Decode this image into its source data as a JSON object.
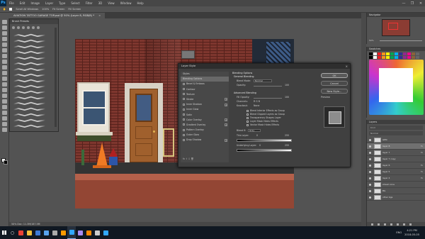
{
  "app": {
    "title_icon": "Ps"
  },
  "menubar": {
    "items": [
      "File",
      "Edit",
      "Image",
      "Layer",
      "Type",
      "Select",
      "Filter",
      "3D",
      "View",
      "Window",
      "Help"
    ],
    "win": [
      "—",
      "❐",
      "✕"
    ]
  },
  "options": {
    "items": [
      "Scroll All Windows",
      "100%",
      "Fit Screen",
      "Fill Screen"
    ]
  },
  "document": {
    "tab_label": "AVIATION TATTOO GARAGE TOP.psd @ 50% (Layer 8, RGB/8) *",
    "tab_close": "×"
  },
  "brush_panel": {
    "title": "Brush Presets"
  },
  "dialog": {
    "title": "Layer Style",
    "close": "×",
    "side_items": [
      {
        "label": "Styles",
        "cb": false,
        "plus": false,
        "sel": false
      },
      {
        "label": "Blending Options",
        "cb": false,
        "plus": false,
        "sel": true
      },
      {
        "label": "Bevel & Emboss",
        "cb": true,
        "plus": false,
        "sel": false
      },
      {
        "label": "Contour",
        "cb": true,
        "plus": false,
        "sel": false
      },
      {
        "label": "Texture",
        "cb": true,
        "plus": false,
        "sel": false
      },
      {
        "label": "Stroke",
        "cb": true,
        "plus": true,
        "sel": false
      },
      {
        "label": "Inner Shadow",
        "cb": true,
        "plus": true,
        "sel": false
      },
      {
        "label": "Inner Glow",
        "cb": true,
        "plus": false,
        "sel": false
      },
      {
        "label": "Satin",
        "cb": true,
        "plus": false,
        "sel": false
      },
      {
        "label": "Color Overlay",
        "cb": true,
        "plus": true,
        "sel": false
      },
      {
        "label": "Gradient Overlay",
        "cb": true,
        "plus": true,
        "sel": false
      },
      {
        "label": "Pattern Overlay",
        "cb": true,
        "plus": false,
        "sel": false
      },
      {
        "label": "Outer Glow",
        "cb": true,
        "plus": false,
        "sel": false
      },
      {
        "label": "Drop Shadow",
        "cb": true,
        "plus": true,
        "sel": false
      }
    ],
    "fx_label": "fx  ⇧ ⇩  🗑",
    "blending": {
      "section": "Blending Options",
      "general": "General Blending",
      "blend_mode_label": "Blend Mode:",
      "blend_mode_value": "Normal",
      "opacity_label": "Opacity:",
      "opacity_value": "100",
      "advanced": "Advanced Blending",
      "fill_label": "Fill Opacity:",
      "fill_value": "100",
      "channels_label": "Channels:",
      "channels": "R  G  B",
      "knockout_label": "Knockout:",
      "knockout_value": "None",
      "checks": [
        "Blend Interior Effects as Group",
        "Blend Clipped Layers as Group",
        "Transparency Shapes Layer",
        "Layer Mask Hides Effects",
        "Vector Mask Hides Effects"
      ],
      "blend_if_label": "Blend If:",
      "blend_if_value": "Gray",
      "this_layer": "This Layer:",
      "this_layer_lo": "0",
      "this_layer_hi": "255",
      "underlying": "Underlying Layer:",
      "underlying_lo": "0",
      "underlying_hi": "255"
    },
    "buttons": {
      "ok": "OK",
      "cancel": "Cancel",
      "new_style": "New Style...",
      "preview": "Preview"
    }
  },
  "panels": {
    "navigator": {
      "title": "Navigator",
      "zoom": "50%"
    },
    "swatches": {
      "title": "Swatches"
    },
    "layers": {
      "title": "Layers",
      "kind": "Kind",
      "mode": "Normal",
      "rows": [
        {
          "name": "GEN",
          "sel": false,
          "fx": false
        },
        {
          "name": "layer 8",
          "sel": true,
          "fx": true
        },
        {
          "name": "layer 7",
          "sel": false,
          "fx": true
        },
        {
          "name": "layer 7 copy",
          "sel": false,
          "fx": false
        },
        {
          "name": "layer 6",
          "sel": false,
          "fx": true
        },
        {
          "name": "layer 5",
          "sel": false,
          "fx": true
        },
        {
          "name": "layer 4",
          "sel": false,
          "fx": true
        },
        {
          "name": "street cone",
          "sel": false,
          "fx": false
        },
        {
          "name": "BG",
          "sel": false,
          "fx": false
        },
        {
          "name": "other bgs",
          "sel": false,
          "fx": false
        }
      ]
    }
  },
  "status": {
    "text": "50%     Doc: 11.3M/187.5M"
  },
  "taskbar": {
    "time": "4:21 PM",
    "date": "2018-05-05",
    "lang": "ENG",
    "apps": [
      {
        "icon": "chrome-icon",
        "color": "#e94235",
        "active": false
      },
      {
        "icon": "file-explorer-icon",
        "color": "#f3c03b",
        "active": false
      },
      {
        "icon": "mail-icon",
        "color": "#3d7ad6",
        "active": false
      },
      {
        "icon": "store-icon",
        "color": "#58a3ee",
        "active": false
      },
      {
        "icon": "steam-icon",
        "color": "#aaaaaa",
        "active": false
      },
      {
        "icon": "illustrator-icon",
        "color": "#ff9a00",
        "active": false
      },
      {
        "icon": "photoshop-icon",
        "color": "#31a8ff",
        "active": true
      },
      {
        "icon": "premiere-icon",
        "color": "#a98cf4",
        "active": false
      },
      {
        "icon": "vlc-icon",
        "color": "#ff8800",
        "active": false
      },
      {
        "icon": "settings-icon",
        "color": "#cccccc",
        "active": false
      },
      {
        "icon": "ps-icon-2",
        "color": "#31a8ff",
        "active": false
      }
    ]
  },
  "colors": {
    "accent": "#31a8ff",
    "panel": "#535353",
    "dialog": "#404040"
  }
}
